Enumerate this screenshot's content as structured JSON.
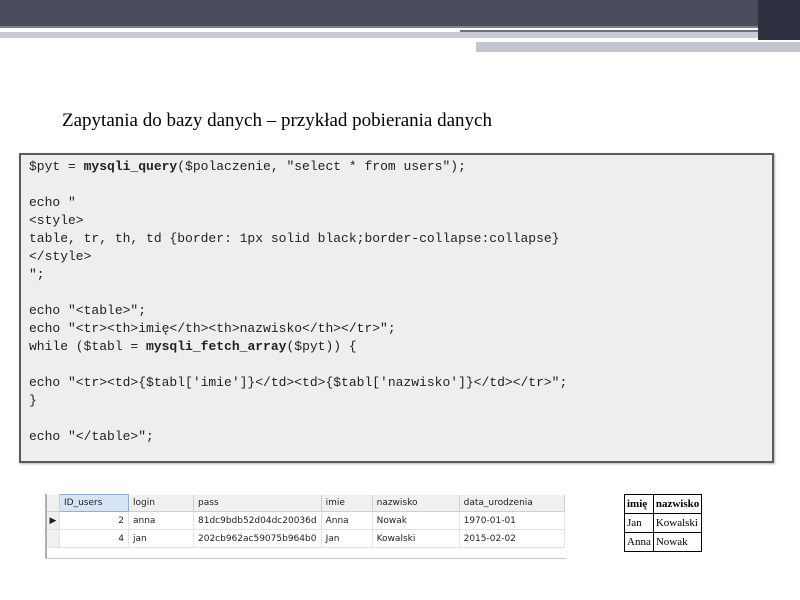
{
  "title": "Zapytania do bazy danych – przykład pobierania danych",
  "code": {
    "lines": [
      [
        {
          "t": "$pyt = "
        },
        {
          "t": "mysqli_query",
          "b": true
        },
        {
          "t": "($polaczenie, \"select * from users\");"
        }
      ],
      [],
      [
        {
          "t": "echo \""
        }
      ],
      [
        {
          "t": "<style>"
        }
      ],
      [
        {
          "t": "table, tr, th, td {border: 1px solid black;border-collapse:collapse}"
        }
      ],
      [
        {
          "t": "</style>"
        }
      ],
      [
        {
          "t": "\";"
        }
      ],
      [],
      [
        {
          "t": "echo \"<table>\";"
        }
      ],
      [
        {
          "t": "echo \"<tr><th>imię</th><th>nazwisko</th></tr>\";"
        }
      ],
      [
        {
          "t": "while ($tabl = "
        },
        {
          "t": "mysqli_fetch_array",
          "b": true
        },
        {
          "t": "($pyt)) {"
        }
      ],
      [],
      [
        {
          "t": "echo \"<tr><td>{$tabl['imie']}</td><td>{$tabl['nazwisko']}</td></tr>\";"
        }
      ],
      [
        {
          "t": "}"
        }
      ],
      [],
      [
        {
          "t": "echo \"</table>\";"
        }
      ]
    ]
  },
  "db_grid": {
    "columns": [
      "ID_users",
      "login",
      "pass",
      "imie",
      "nazwisko",
      "data_urodzenia"
    ],
    "rows": [
      {
        "selected": true,
        "cells": [
          "2",
          "anna",
          "81dc9bdb52d04dc20036d",
          "Anna",
          "Nowak",
          "1970-01-01"
        ]
      },
      {
        "selected": false,
        "cells": [
          "4",
          "jan",
          "202cb962ac59075b964b0",
          "Jan",
          "Kowalski",
          "2015-02-02"
        ]
      }
    ],
    "selected_marker": "▶"
  },
  "result_table": {
    "headers": [
      "imię",
      "nazwisko"
    ],
    "rows": [
      [
        "Jan",
        "Kowalski"
      ],
      [
        "Anna",
        "Nowak"
      ]
    ]
  }
}
